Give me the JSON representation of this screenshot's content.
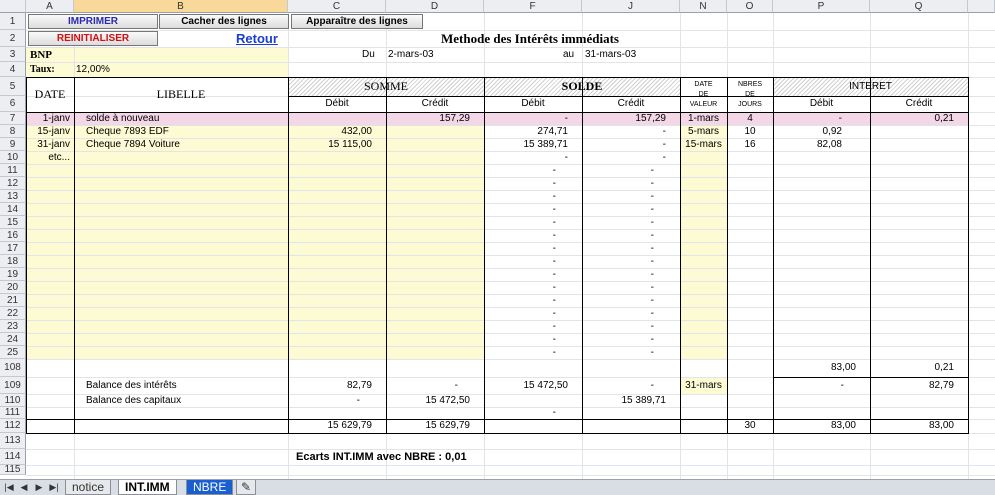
{
  "columns": [
    "A",
    "B",
    "C",
    "D",
    "F",
    "J",
    "N",
    "O",
    "P",
    "Q"
  ],
  "rows": [
    "1",
    "2",
    "3",
    "4",
    "5",
    "6",
    "7",
    "8",
    "9",
    "10",
    "11",
    "12",
    "13",
    "14",
    "15",
    "16",
    "17",
    "18",
    "19",
    "20",
    "21",
    "22",
    "23",
    "24",
    "25",
    "108",
    "109",
    "110",
    "111",
    "112",
    "113",
    "114",
    "115"
  ],
  "buttons": {
    "imprimer": "IMPRIMER",
    "cacher": "Cacher des lignes",
    "apparaitre": "Apparaître des  lignes",
    "reinitialiser": "REINITIALISER"
  },
  "link": "Retour",
  "title": "Methode des Intérêts immédiats",
  "bank": "BNP",
  "period": {
    "from_label": "Du",
    "from": "2-mars-03",
    "to_label": "au",
    "to": "31-mars-03"
  },
  "rate": {
    "label": "Taux:",
    "value": "12,00%"
  },
  "headers": {
    "date": "DATE",
    "libelle": "LIBELLE",
    "somme": "SOMME",
    "solde": "SOLDE",
    "date_valeur": [
      "DATE",
      "DE",
      "VALEUR"
    ],
    "nbres_jours": [
      "NBRES",
      "DE",
      "JOURS"
    ],
    "interet": "INTERET",
    "debit": "Débit",
    "credit": "Crédit"
  },
  "data_rows": [
    {
      "date": "1-janv",
      "libelle": "solde à nouveau",
      "somme_debit": "",
      "somme_credit": "157,29",
      "solde_debit": "-",
      "solde_credit": "157,29",
      "date_valeur": "1-mars",
      "jours": "4",
      "int_debit": "-",
      "int_credit": "0,21"
    },
    {
      "date": "15-janv",
      "libelle": "Cheque 7893 EDF",
      "somme_debit": "432,00",
      "somme_credit": "",
      "solde_debit": "274,71",
      "solde_credit": "-",
      "date_valeur": "5-mars",
      "jours": "10",
      "int_debit": "0,92",
      "int_credit": ""
    },
    {
      "date": "31-janv",
      "libelle": "Cheque 7894 Voiture",
      "somme_debit": "15 115,00",
      "somme_credit": "",
      "solde_debit": "15 389,71",
      "solde_credit": "-",
      "date_valeur": "15-mars",
      "jours": "16",
      "int_debit": "82,08",
      "int_credit": ""
    },
    {
      "date": "etc...",
      "libelle": "",
      "somme_debit": "",
      "somme_credit": "",
      "solde_debit": "-",
      "solde_credit": "-",
      "date_valeur": "",
      "jours": "",
      "int_debit": "",
      "int_credit": ""
    }
  ],
  "dash": "-",
  "totals_108": {
    "int_debit": "83,00",
    "int_credit": "0,21"
  },
  "balance_interets": {
    "label": "Balance des intérêts",
    "somme_debit": "82,79",
    "somme_credit": "-",
    "solde_debit": "15 472,50",
    "solde_credit": "-",
    "date_valeur": "31-mars",
    "int_debit": "-",
    "int_credit": "82,79"
  },
  "balance_capitaux": {
    "label": "Balance des capitaux",
    "somme_debit": "-",
    "somme_credit": "15 472,50",
    "solde_credit": "15 389,71"
  },
  "row111": {
    "solde_debit": "-"
  },
  "row112": {
    "somme_debit": "15 629,79",
    "somme_credit": "15 629,79",
    "jours": "30",
    "int_debit": "83,00",
    "int_credit": "83,00"
  },
  "ecarts": "Ecarts INT.IMM avec NBRE : 0,01",
  "tabs": [
    "notice",
    "INT.IMM",
    "NBRE"
  ]
}
